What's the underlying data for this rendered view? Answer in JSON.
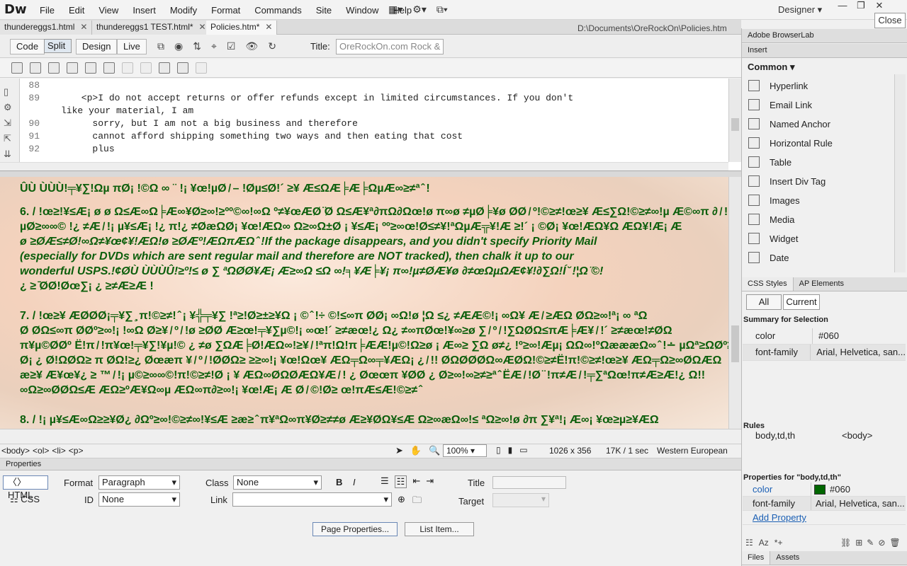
{
  "app": {
    "logo": "Dw",
    "menu": [
      "File",
      "Edit",
      "View",
      "Insert",
      "Modify",
      "Format",
      "Commands",
      "Site",
      "Window",
      "Help"
    ],
    "workspace": "Designer",
    "close_tooltip": "Close"
  },
  "doc_tabs": [
    {
      "label": "thundereggs1.html"
    },
    {
      "label": "thundereggs1 TEST.html*"
    },
    {
      "label": "Policies.htm*"
    }
  ],
  "doc_path": "D:\\Documents\\OreRockOn\\Policies.htm",
  "view_buttons": [
    "Code",
    "Split",
    "Design",
    "Live"
  ],
  "title_label": "Title:",
  "title_value": "OreRockOn.com Rock & D",
  "code_lines": [
    {
      "num": "88",
      "text": ""
    },
    {
      "num": "89",
      "text": "      <p>I do not accept returns or offer refunds except in limited circumstances. If you don't"
    },
    {
      "num": "",
      "text": "like your material, I am"
    },
    {
      "num": "90",
      "text": "        sorry, but I am not a big business and therefore"
    },
    {
      "num": "91",
      "text": "        cannot afford shipping something two ways and then eating that cost"
    },
    {
      "num": "92",
      "text": "        plus"
    }
  ],
  "design_lines": [
    {
      "text": "ÛÙ  ÙÙÙ!╤¥∑!Ωµ πØ¡ !©Ω ∞ ¨ !¡ ¥œ!µØ ̸ – !Øµ≤Ø!´ ≥¥ Æ≤ΩÆ╞Æ╞ΩµÆ∞≥≠ª ̂ !"
    },
    {
      "text": "6.  / !œ≥!¥≤Æ¡ ø ø Ω≤Æ∞Ω╞Æ∞¥Ø≥∞!≥ºº©∞!∞Ω º≠¥œÆØ ̈Ø Ω≤Æ¥ª∂πΩ∂Ωœ!ø π∞ø ≠µØ╞¥ø ØØ ̸ º!©≥≠!œ≥¥ Æ≤∑Ω!©≥≠∞!µ Æ©∞π ∂ ̸ !"
    },
    {
      "text": "    µØ≥∞∞©  !¿ ≠Æ ̸ !¡ µ¥≤Æ¡ !¿ π!¿ ≠ØæΩØ¡ ¥œ!ÆΩ∞ Ω≥∞Ω±Ø ¡ ¥≤Æ¡ ºº≥∞œ!Ø≤≠¥!ªΩµÆ╦¥!Æ ≥!´ ¡ ©Ø¡ ¥œ!ÆΩ¥Ω ÆΩ¥!Æ¡ Æ"
    },
    {
      "text": "    ø ≥ØÆ≤≠Ø!∞Ω≠¥œ¢¥!ÆΩ!ø ≥ØÆº!ÆΩπÆΩ ̂  !If the package disappears, and you didn't specify Priority Mail"
    },
    {
      "text": "    (especially for DVDs which are sent regular mail and therefore are NOT tracked), then chalk it up to our"
    },
    {
      "text": "    wonderful USPS.!¢ØÙ ÙÙÙÛ!≥º!≤ ø ∑ ªΩØØ¥Æ¡ Æ≥∞Ω ≤Ω ∞!╕¥Æ╞¥¡ π∞!µ≠ØÆ¥ø ∂≠œΩµΩÆ¢¥!∂∑Ω!Í ̆ !¦Ω ̈©!"
    },
    {
      "text": "    ¿ ≥ ̄ØØ!Øœ∑¡ ¿ ≥≠Æ≥Æ !"
    },
    {
      "text": ""
    },
    {
      "text": "7.  / !œ≥¥ ÆØØØ¡╤¥∑ ̧ π!©≥≠! ̂ ¡ ¥╬╤¥∑ !ª≥!Ø≥±≥¥Ω ¡ © ̂ !÷ ©!≤∞π ØØ¡ ∞Ω!ø ¦Ω ≤¿ ≠ÆÆ©!¡ ∞Ω¥ Æ ̸ ≥ÆΩ ØΩ≥∞!ª¡ ∞ ªΩ"
    },
    {
      "text": "    Ø ØΩ≤∞π ØØº≥∞!¡ !∞Ω Ø≥¥ ̸ º ̸ !ø ≥ØØ Æ≥œ!╤¥∑µ©!¡ ∞œ!´ ≥≠æœ!¿ Ω¿ ≠∞πØœ!¥∞≥ø ∑ ̸ º ̸ !∑ΩØΩ≤πÆ╞Æ¥ ̸ !´ ≥≠æœ!≠ØΩ"
    },
    {
      "text": "    π¥µ©ØØº Ë!π ̸ !π¥œ!╤¥∑!¥µ!© ¿ ≠ø ∑ΩÆ╞Ø!ÆΩ∞!≥¥ ̸ !ªπ!Ω!π╞ÆÆ!µ©!Ω≥ø ¡ Æ∞≥ ∑Ω ø≠¿ !º≥∞!Æµ¡ ΩΩ∞!ºΩæææΩ∞ ̂ !∸ µΩª≥ΩØº≥∞!!"
    },
    {
      "text": "    Ø¡ ¿ Ø!ΩØΩ≥ π ØΩ!≥¿ Øœæπ ¥ ̸ º ̸ !ØØΩ≥ ≥≥∞!¡ ¥œ!Ωœ¥ ÆΩ╤Ω∞╤¥ÆΩ¡ ¿ ̸ !! ØΩØØØΩ∞ÆØΩ!©≥≠Ë!π!©≥≠!œ≥¥ ÆΩ╤Ω≥∞ØΩÆΩ"
    },
    {
      "text": "    æ≥¥ Æ¥œ¥¿ ≥ ™ ̸ !¡ µ©≥∞∞©!π!©≥≠!Ø ¡ ¥ ÆΩ∞ØΩØÆΩ¥Æ ̸ ! ¿ Øœœπ ¥ØØ ¿ Ø≥∞!∞≥≠≥ª ̂ ËÆ ̸ !Ø ̈ !π≠Æ ̸ !╤∑ªΩœ!π≠Æ≥Æ!¿ Ω!!"
    },
    {
      "text": "    ∞Ω≥∞ØØΩ≤Æ ÆΩ≥ºÆ¥Ω∞µ ÆΩ∞π∂≥∞!¡ ¥œ!Æ¡ Æ Ø ̸ ©!Ø≥ œ!πÆ≤Æ!©≥≠ ̂ "
    },
    {
      "text": ""
    },
    {
      "text": "8.  / !¡ µ¥≤Æ∞Ω≥≥¥Ø¿ ∂Ωº≥∞!©≥≠∞!¥≤Æ ≥æ≥ ̂ π¥ªΩ∞π¥Ø≥≠≠ø Æ≥¥ØΩ¥≤Æ Ω≥∞æΩ∞!≤ ªΩ≥∞!ø ∂π ∑¥ª!¡ Æ∞¡ ¥œ≥µ≥¥ÆΩ"
    }
  ],
  "status": {
    "tags": [
      "<body>",
      "<ol>",
      "<li>",
      "<p>"
    ],
    "zoom": "100%",
    "size": "1026 x 356",
    "weight": "17K / 1 sec",
    "encoding": "Western European"
  },
  "properties": {
    "header": "Properties",
    "html_label": "HTML",
    "css_label": "CSS",
    "format_label": "Format",
    "format_value": "Paragraph",
    "class_label": "Class",
    "class_value": "None",
    "id_label": "ID",
    "id_value": "None",
    "link_label": "Link",
    "title_label": "Title",
    "target_label": "Target",
    "bold": "B",
    "italic": "I",
    "page_properties": "Page Properties...",
    "list_item": "List Item..."
  },
  "right": {
    "browserlab": "Adobe BrowserLab",
    "insert": "Insert",
    "common": "Common",
    "insert_items": [
      "Hyperlink",
      "Email Link",
      "Named Anchor",
      "Horizontal Rule",
      "Table",
      "Insert Div Tag",
      "Images",
      "Media",
      "Widget",
      "Date"
    ],
    "css_styles": "CSS Styles",
    "ap_elements": "AP Elements",
    "all": "All",
    "current": "Current",
    "summary": "Summary for Selection",
    "summary_rows": [
      {
        "prop": "color",
        "val": "#060"
      },
      {
        "prop": "font-family",
        "val": "Arial, Helvetica, san..."
      }
    ],
    "rules": "Rules",
    "rules_row": {
      "a": "body,td,th",
      "b": "<body>"
    },
    "properties_for": "Properties for \"body,td,th\"",
    "prop_rows": [
      {
        "prop": "color",
        "val": "#060"
      },
      {
        "prop": "font-family",
        "val": "Arial, Helvetica, san..."
      }
    ],
    "add_property": "Add Property",
    "files": "Files",
    "assets": "Assets",
    "swatch": "#006600"
  }
}
